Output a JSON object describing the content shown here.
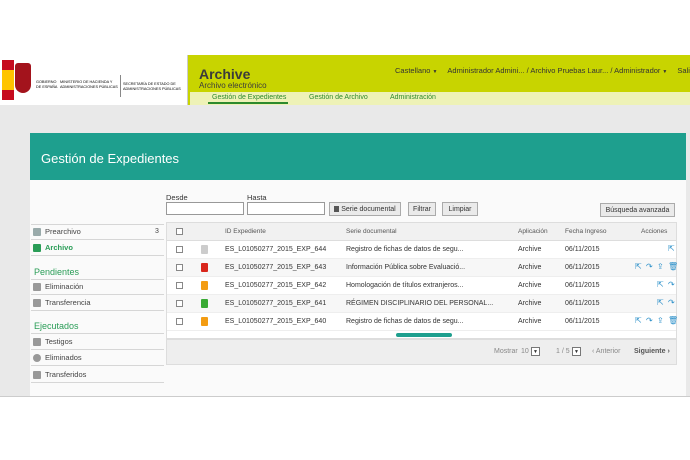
{
  "header": {
    "logo_gov_text": "GOBIERNO DE ESPAÑA",
    "logo_ministry_text": "MINISTERIO DE HACIENDA Y ADMINISTRACIONES PÚBLICAS",
    "logo_secretariat_text": "SECRETARÍA DE ESTADO DE ADMINISTRACIONES PÚBLICAS",
    "app_title": "Archive",
    "app_subtitle": "Archivo electrónico",
    "language": "Castellano",
    "user_path": "Administrador Admini... / Archivo Pruebas Laur... / Administrador",
    "exit": "Salir"
  },
  "subnav": {
    "items": [
      "Gestión de Expedientes",
      "Gestión de Archivo",
      "Administración"
    ],
    "active": "Gestión de Expedientes"
  },
  "section": {
    "title": "Gestión de Expedientes"
  },
  "sidebar": {
    "top_items": [
      {
        "label": "Prearchivo",
        "count": "3"
      },
      {
        "label": "Archivo"
      }
    ],
    "pendientes_title": "Pendientes",
    "pendientes": [
      {
        "label": "Eliminación"
      },
      {
        "label": "Transferencia"
      }
    ],
    "ejecutados_title": "Ejecutados",
    "ejecutados": [
      {
        "label": "Testigos"
      },
      {
        "label": "Eliminados"
      },
      {
        "label": "Transferidos"
      }
    ]
  },
  "filters": {
    "desde_label": "Desde",
    "hasta_label": "Hasta",
    "desde_value": "",
    "hasta_value": "",
    "serie_button": "Serie documental",
    "filtrar_button": "Filtrar",
    "limpiar_button": "Limpiar",
    "advanced_button": "Búsqueda avanzada"
  },
  "table": {
    "columns": [
      "ID Expediente",
      "Serie documental",
      "Aplicación",
      "Fecha Ingreso",
      "Acciones"
    ],
    "rows": [
      {
        "id": "ES_L01050277_2015_EXP_644",
        "serie": "Registro de fichas de datos de segu...",
        "aplicacion": "Archive",
        "fecha": "06/11/2015",
        "icon_color": "#cccccc"
      },
      {
        "id": "ES_L01050277_2015_EXP_643",
        "serie": "Información Pública sobre Evaluació...",
        "aplicacion": "Archive",
        "fecha": "06/11/2015",
        "icon_color": "#d9261c"
      },
      {
        "id": "ES_L01050277_2015_EXP_642",
        "serie": "Homologación de títulos extranjeros...",
        "aplicacion": "Archive",
        "fecha": "06/11/2015",
        "icon_color": "#f39c12"
      },
      {
        "id": "ES_L01050277_2015_EXP_641",
        "serie": "RÉGIMEN DISCIPLINARIO DEL PERSONAL...",
        "aplicacion": "Archive",
        "fecha": "06/11/2015",
        "icon_color": "#3aaa35"
      },
      {
        "id": "ES_L01050277_2015_EXP_640",
        "serie": "Registro de fichas de datos de segu...",
        "aplicacion": "Archive",
        "fecha": "06/11/2015",
        "icon_color": "#f39c12"
      }
    ]
  },
  "pager": {
    "mostrar_label": "Mostrar",
    "page_size": "10",
    "page_info": "1 / 5",
    "prev": "Anterior",
    "next": "Siguiente"
  },
  "colors": {
    "header_accent": "#c8d400",
    "section_teal": "#1e9f8e",
    "green_text": "#2a9d57",
    "action_blue": "#2a8fc9"
  }
}
